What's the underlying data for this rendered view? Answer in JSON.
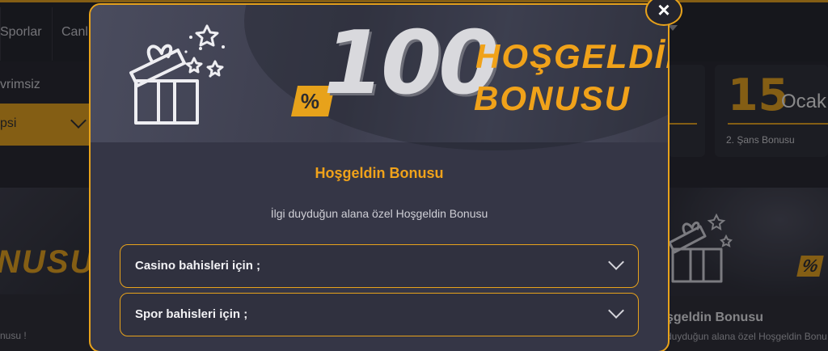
{
  "nav": {
    "items": [
      "Sporlar",
      "Canl"
    ]
  },
  "filters": {
    "label": "vrimsiz",
    "select_value": "psi"
  },
  "date_card": {
    "day": "15",
    "month": "Ocak",
    "caption": "2. Şans Bonusu"
  },
  "left_promo": {
    "headline": "NUSU",
    "caption": "nusu !"
  },
  "right_promo": {
    "percent": "%",
    "title": "şgeldin Bonusu",
    "subtitle": "duyduğun alana özel Hoşgeldin Bonu"
  },
  "modal": {
    "banner": {
      "percent_sign": "%",
      "amount": "100",
      "line1": "HOŞGELDİN",
      "line2": "BONUSU"
    },
    "title": "Hoşgeldin Bonusu",
    "subtitle": "İlgi duyduğun alana özel Hoşgeldin Bonusu",
    "accordions": [
      {
        "label": "Casino bahisleri için ;"
      },
      {
        "label": "Spor bahisleri için ;"
      }
    ],
    "close_label": "×"
  },
  "colors": {
    "accent": "#e7a21b",
    "modal_bg": "#353646",
    "page_bg": "#23242c"
  },
  "icons": {
    "gift": "gift-box-icon",
    "close": "close-icon",
    "chevron": "chevron-down-icon"
  }
}
